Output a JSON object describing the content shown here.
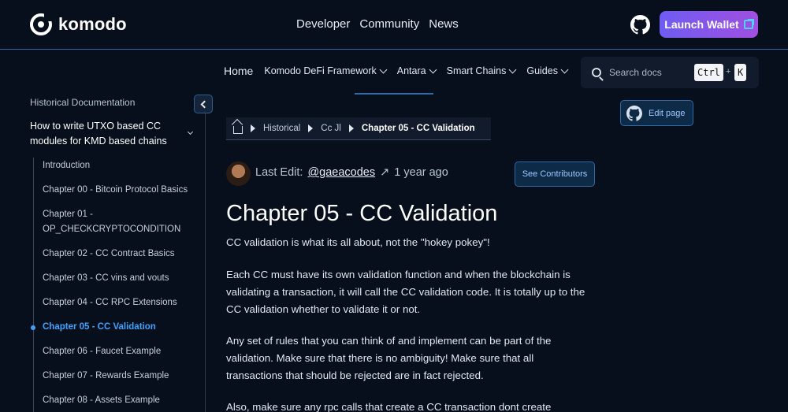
{
  "header": {
    "logo_text": "komodo",
    "nav": [
      "Developer",
      "Community",
      "News"
    ],
    "launch_wallet": "Launch Wallet"
  },
  "subnav": {
    "home": "Home",
    "items": [
      "Komodo DeFi Framework",
      "Antara",
      "Smart Chains",
      "Guides"
    ],
    "search_placeholder": "Search docs",
    "kbd_ctrl": "Ctrl",
    "kbd_plus": "+",
    "kbd_k": "K"
  },
  "sidebar": {
    "heading": "Historical Documentation",
    "section_title": "How to write UTXO based CC modules for KMD based chains",
    "items": [
      "Introduction",
      "Chapter 00 - Bitcoin Protocol Basics",
      "Chapter 01 - OP_CHECKCRYPTOCONDITION",
      "Chapter 02 - CC Contract Basics",
      "Chapter 03 - CC vins and vouts",
      "Chapter 04 - CC RPC Extensions",
      "Chapter 05 - CC Validation",
      "Chapter 06 - Faucet Example",
      "Chapter 07 - Rewards Example",
      "Chapter 08 - Assets Example"
    ],
    "active_index": 6
  },
  "breadcrumb": [
    "Historical",
    "Cc Jl",
    "Chapter 05 - CC Validation"
  ],
  "edit_info": {
    "label": "Last Edit:",
    "user": "@gaeacodes",
    "arrow": "↗",
    "time": "1 year ago",
    "contributors_btn": "See Contributors",
    "edit_page": "Edit page"
  },
  "content": {
    "title": "Chapter 05 - CC Validation",
    "paragraphs": [
      "CC validation is what its all about, not the \"hokey pokey\"!",
      "Each CC must have its own validation function and when the blockchain is validating a transaction, it will call the CC validation code. It is totally up to the CC validation whether to validate it or not.",
      "Any set of rules that you can think of and implement can be part of the validation. Make sure that there is no ambiguity! Make sure that all transactions that should be rejected are in fact rejected.",
      "Also, make sure any rpc calls that create a CC transaction dont create"
    ]
  },
  "colors": {
    "background": "#070f1c",
    "accent": "#3ea3ff",
    "launch_gradient_start": "#6f5cf2",
    "launch_gradient_end": "#a04fe0"
  }
}
